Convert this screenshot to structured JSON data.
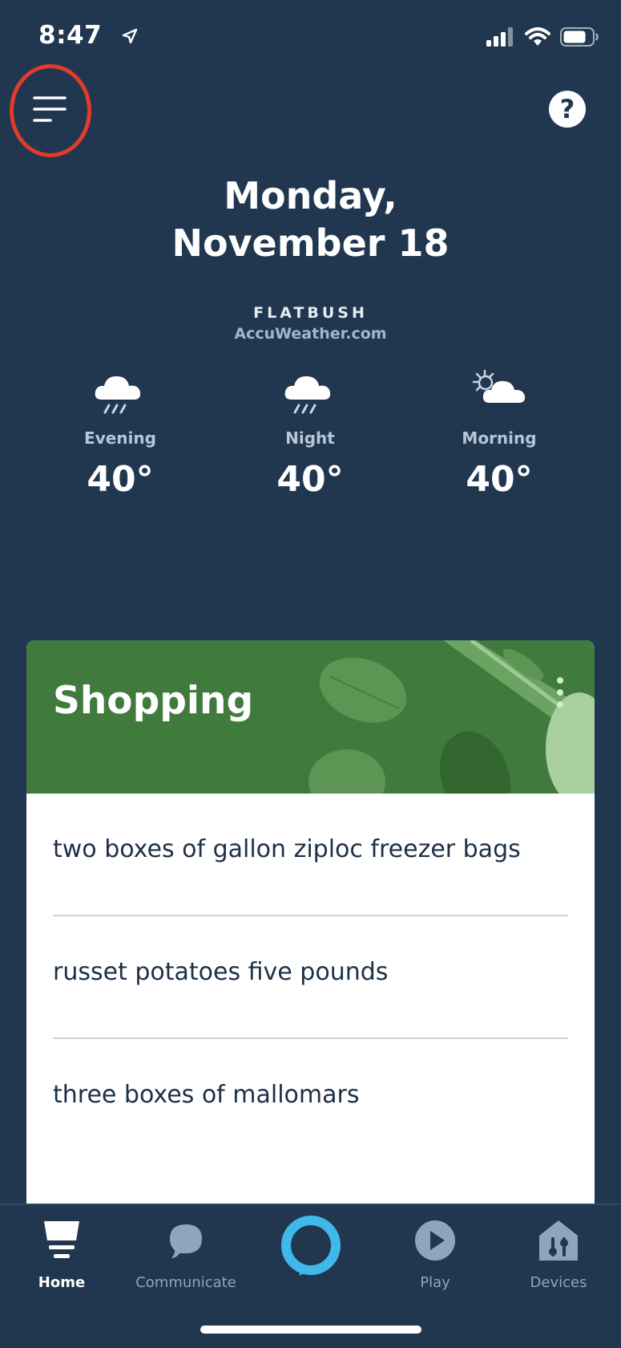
{
  "status_bar": {
    "time": "8:47"
  },
  "header": {
    "date_line1": "Monday,",
    "date_line2": "November 18",
    "help_label": "?"
  },
  "weather": {
    "location": "FLATBUSH",
    "source": "AccuWeather.com",
    "forecasts": [
      {
        "period": "Evening",
        "temp": "40°",
        "icon": "rain-cloud-icon"
      },
      {
        "period": "Night",
        "temp": "40°",
        "icon": "rain-cloud-icon"
      },
      {
        "period": "Morning",
        "temp": "40°",
        "icon": "partly-sunny-icon"
      }
    ]
  },
  "shopping_card": {
    "title": "Shopping",
    "items": [
      "two boxes of gallon ziploc freezer bags",
      "russet potatoes five pounds",
      "three boxes of mallomars"
    ]
  },
  "tab_bar": {
    "tabs": [
      {
        "label": "Home",
        "icon": "home-icon",
        "active": true
      },
      {
        "label": "Communicate",
        "icon": "speech-bubble-icon",
        "active": false
      },
      {
        "label": "",
        "icon": "alexa-ring-icon",
        "active": false
      },
      {
        "label": "Play",
        "icon": "play-icon",
        "active": false
      },
      {
        "label": "Devices",
        "icon": "devices-icon",
        "active": false
      }
    ]
  },
  "colors": {
    "background": "#21374f",
    "card_header": "#417a3d",
    "highlight": "#e23b2c",
    "alexa_ring": "#3fb8ea"
  }
}
